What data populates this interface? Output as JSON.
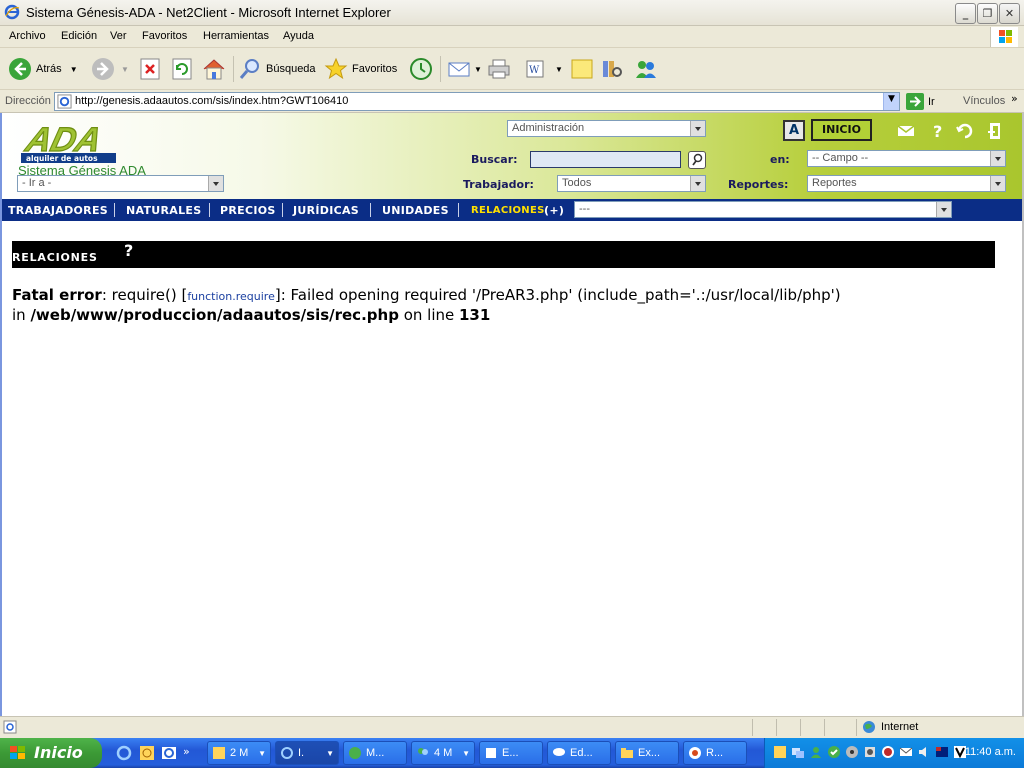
{
  "window": {
    "title": "Sistema Génesis-ADA - Net2Client - Microsoft Internet Explorer"
  },
  "menu": [
    "Archivo",
    "Edición",
    "Ver",
    "Favoritos",
    "Herramientas",
    "Ayuda"
  ],
  "toolbar": {
    "back": "Atrás",
    "search": "Búsqueda",
    "favorites": "Favoritos"
  },
  "address": {
    "label": "Dirección",
    "url": "http://genesis.adaautos.com/sis/index.htm?GWT106410",
    "go": "Ir",
    "links": "Vínculos"
  },
  "header": {
    "system_name": "Sistema Génesis ADA",
    "goto_select": "- Ir a -",
    "admin_select": "Administración",
    "search_label": "Buscar:",
    "en_label": "en:",
    "campo_select": "-- Campo --",
    "worker_label": "Trabajador:",
    "worker_select": "Todos",
    "reports_label": "Reportes:",
    "reports_select": "Reportes",
    "a_button": "A",
    "inicio_button": "INICIO"
  },
  "nav": {
    "items": [
      "TRABAJADORES",
      "NATURALES",
      "PRECIOS",
      "JURÍDICAS",
      "UNIDADES"
    ],
    "active": "RELACIONES",
    "active_suffix": "(+)",
    "select": "---"
  },
  "section": {
    "title": "RELACIONES",
    "help": "?"
  },
  "error": {
    "label": "Fatal error",
    "p1": ": require() [",
    "fn": "function.require",
    "p2": "]: Failed opening required '/PreAR3.php' (include_path='.:/usr/local/lib/php')",
    "in": "in ",
    "path": "/web/www/produccion/adaautos/sis/rec.php",
    "on_line": " on line ",
    "line": "131"
  },
  "status": {
    "zone": "Internet"
  },
  "taskbar": {
    "start": "Inicio",
    "tasks": [
      {
        "label": "2 M",
        "count_color": "#ff6a3c"
      },
      {
        "label": "I."
      },
      {
        "label": "M..."
      },
      {
        "label": "4 M"
      },
      {
        "label": "E..."
      },
      {
        "label": "Ed..."
      },
      {
        "label": "Ex..."
      },
      {
        "label": "R..."
      }
    ],
    "clock": "11:40 a.m."
  }
}
